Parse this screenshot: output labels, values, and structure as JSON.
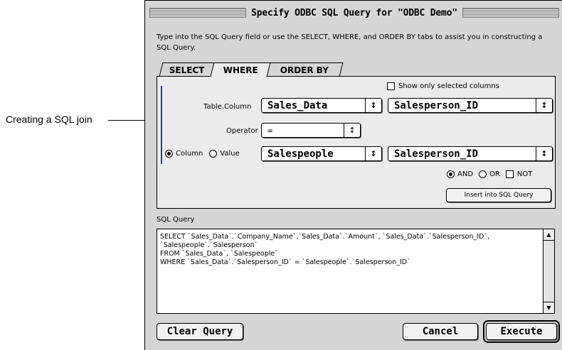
{
  "callout": {
    "text": "Creating a SQL join"
  },
  "window": {
    "title": "Specify ODBC SQL Query for \"ODBC Demo\""
  },
  "intro": "Type into the SQL Query field or use the SELECT, WHERE, and ORDER BY tabs to assist you in constructing a SQL Query.",
  "tabs": [
    {
      "label": "SELECT",
      "active": false
    },
    {
      "label": "WHERE",
      "active": true
    },
    {
      "label": "ORDER BY",
      "active": false
    }
  ],
  "where": {
    "show_selected_label": "Show only selected columns",
    "table_column_label": "Table.Column",
    "table_value": "Sales_Data",
    "column_value": "Salesperson_ID",
    "operator_label": "Operator",
    "operator_value": "=",
    "radio_column_label": "Column",
    "radio_value_label": "Value",
    "right_table_value": "Salespeople",
    "right_column_value": "Salesperson_ID",
    "and_label": "AND",
    "or_label": "OR",
    "not_label": "NOT",
    "insert_label": "Insert into SQL Query"
  },
  "sql": {
    "label": "SQL Query",
    "text": "SELECT `Sales_Data`.`Company_Name`,`Sales_Data`.`Amount`, `Sales_Data`.`Salesperson_ID`,\n`Salespeople`.`Salesperson`\nFROM `Sales_Data`, `Salespeople`\nWHERE `Sales_Data`.`Salesperson_ID` = `Salespeople`.`Salesperson_ID`"
  },
  "buttons": {
    "clear": "Clear Query",
    "cancel": "Cancel",
    "execute": "Execute"
  },
  "icons": {
    "popup": "updown-arrows-icon",
    "scroll_up": "scroll-up-icon",
    "scroll_down": "scroll-down-icon"
  }
}
